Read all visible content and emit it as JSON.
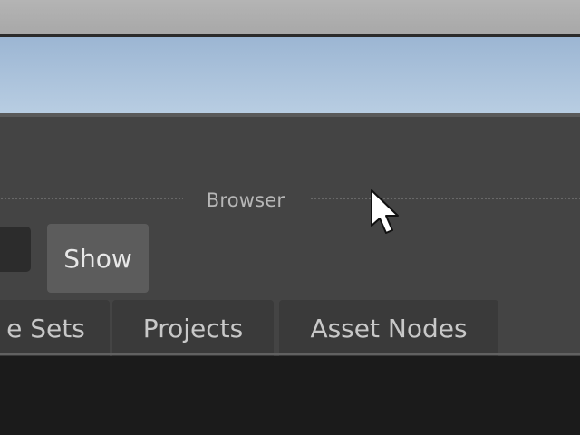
{
  "panel": {
    "header_title": "Browser"
  },
  "toolbar": {
    "show_label": "Show"
  },
  "tabs": [
    {
      "label": "e Sets"
    },
    {
      "label": "Projects"
    },
    {
      "label": "Asset Nodes"
    }
  ],
  "colors": {
    "panel_bg": "#444444",
    "tab_bg": "#3a3a3a",
    "button_bg": "#5c5c5c",
    "sky": "#a7c0db"
  },
  "icons": {
    "cursor": "mouse-pointer-icon"
  }
}
